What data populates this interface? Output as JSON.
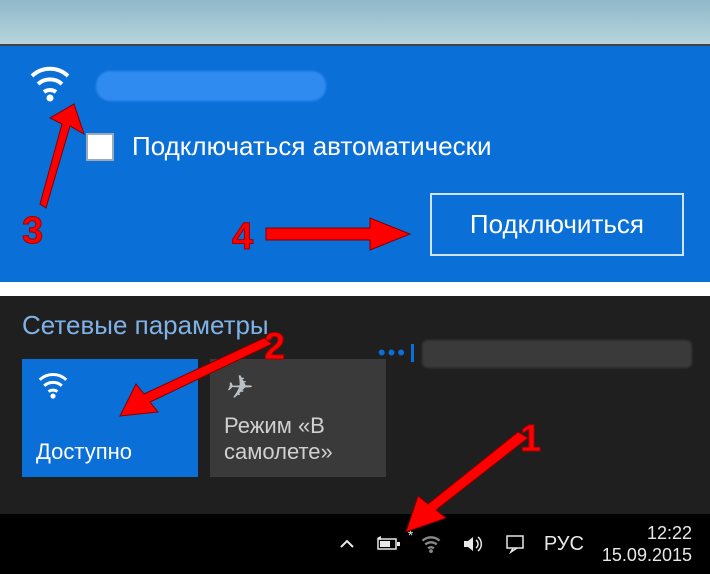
{
  "wifi_panel": {
    "auto_connect_label": "Подключаться автоматически",
    "connect_button": "Подключиться"
  },
  "net_settings": {
    "title": "Сетевые параметры",
    "tiles": {
      "wifi_label": "Доступно",
      "airplane_label": "Режим «В самолете»"
    }
  },
  "taskbar": {
    "lang": "РУС",
    "time": "12:22",
    "date": "15.09.2015"
  },
  "annotations": {
    "n1": "1",
    "n2": "2",
    "n3": "3",
    "n4": "4"
  }
}
